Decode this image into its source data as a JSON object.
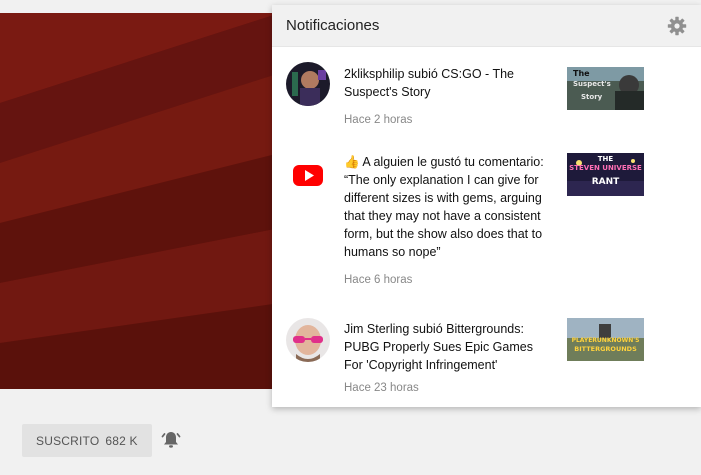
{
  "subscribe": {
    "label": "SUSCRITO",
    "count": "682 K"
  },
  "panel": {
    "title": "Notificaciones",
    "settings_icon": "gear-icon",
    "items": [
      {
        "text": "2kliksphilip subió CS:GO - The Suspect's Story",
        "time": "Hace 2 horas",
        "thumb_label_1": "The",
        "thumb_label_2": "Suspect's",
        "thumb_label_3": "Story"
      },
      {
        "text": "👍 A alguien le gustó tu comentario: “The only explanation I can give for different sizes is with gems, arguing that they may not have a consistent form, but the show also does that to humans so nope”",
        "time": "Hace 6 horas",
        "thumb_label_1": "THE",
        "thumb_label_2": "STEVEN UNIVERSE",
        "thumb_label_3": "RANT"
      },
      {
        "text": "Jim Sterling subió Bittergrounds: PUBG Properly Sues Epic Games For 'Copyright Infringement'",
        "time": "Hace 23 horas",
        "thumb_label_1": "PLAYERUNKNOWN'S",
        "thumb_label_2": "BITTERGROUNDS",
        "thumb_label_3": ""
      }
    ]
  },
  "colors": {
    "banner": "#6e160f",
    "youtube_red": "#ff0000"
  }
}
